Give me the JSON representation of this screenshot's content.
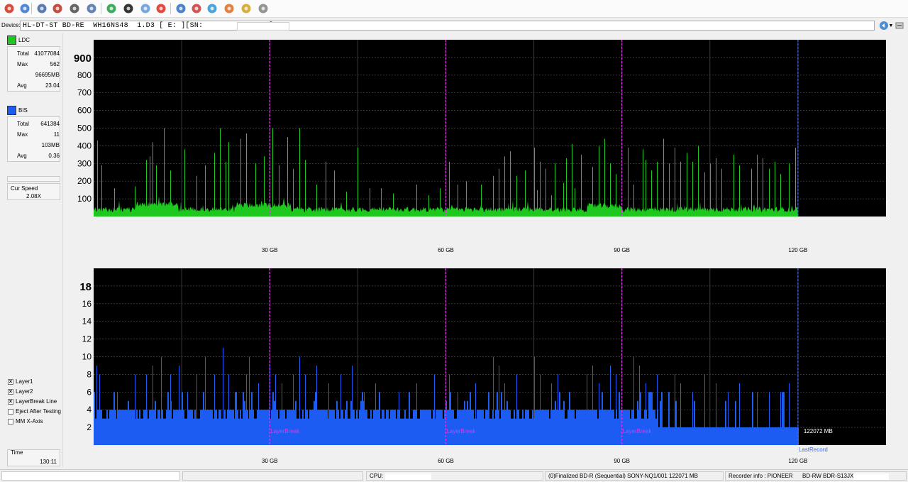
{
  "toolbar": {
    "buttons": [
      {
        "name": "power-icon",
        "color": "#d23a2a"
      },
      {
        "name": "settings-disc-icon",
        "color": "#3d7bd6"
      },
      {
        "name": "drive-info-icon",
        "color": "#4b6ea8"
      },
      {
        "name": "disc-burn-icon",
        "color": "#c0392b"
      },
      {
        "name": "drive-icon",
        "color": "#555555"
      },
      {
        "name": "copy-icon",
        "color": "#5577aa"
      },
      {
        "name": "refresh-icon",
        "color": "#2aa24a"
      },
      {
        "name": "start-test-icon",
        "color": "#1f1f1f"
      },
      {
        "name": "scan-icon",
        "color": "#6aa0d8"
      },
      {
        "name": "stop-icon",
        "color": "#e0362b"
      },
      {
        "name": "disc-icon",
        "color": "#3a76c4"
      },
      {
        "name": "erase-icon",
        "color": "#c44"
      },
      {
        "name": "save-icon",
        "color": "#3a9ad4"
      },
      {
        "name": "burn-icon",
        "color": "#e0732b"
      },
      {
        "name": "chart-icon",
        "color": "#d4a62a"
      },
      {
        "name": "eject-icon",
        "color": "#888888"
      }
    ]
  },
  "device": {
    "label": "Device:",
    "value": "HL-DT-ST BD-RE  WH16NS48  1.D3 [ E: ][SN:               ]"
  },
  "ldc": {
    "label": "LDC",
    "color": "#1ec81e",
    "total_label": "Total",
    "total": "41077084",
    "max_label": "Max",
    "max": "562",
    "size": "96695MB",
    "avg_label": "Avg",
    "avg": "23.04"
  },
  "bis": {
    "label": "BIS",
    "color": "#1c5cf2",
    "total_label": "Total",
    "total": "641384",
    "max_label": "Max",
    "max": "11",
    "size": "103MB",
    "avg_label": "Avg",
    "avg": "0.36"
  },
  "speed": {
    "label": "Cur Speed",
    "value": "2.08X"
  },
  "options": [
    {
      "label": "Layer1",
      "checked": true
    },
    {
      "label": "Layer2",
      "checked": true
    },
    {
      "label": "LayerBreak Line",
      "checked": true
    },
    {
      "label": "Eject After Testing",
      "checked": false
    },
    {
      "label": "MM X-Axis",
      "checked": false
    }
  ],
  "time": {
    "label": "Time",
    "value": "130:11"
  },
  "chart_data": [
    {
      "type": "area",
      "series": [
        {
          "name": "LDC"
        }
      ],
      "x_range_gb": [
        0,
        135
      ],
      "y_range": [
        0,
        1000
      ],
      "y_ticks": [
        100,
        200,
        300,
        400,
        500,
        600,
        700,
        800,
        900
      ],
      "y_top_label": "900",
      "x_ticks_gb": [
        30,
        60,
        90,
        120
      ],
      "x_tick_labels": [
        "30 GB",
        "60 GB",
        "90 GB",
        "120 GB"
      ],
      "layer_breaks_gb": [
        30,
        60,
        90
      ],
      "end_gb": 120,
      "baseline": 35,
      "max": 562,
      "spikes": [
        [
          0.6,
          430
        ],
        [
          1.3,
          290
        ],
        [
          3.5,
          160
        ],
        [
          7,
          170
        ],
        [
          9,
          320
        ],
        [
          9.6,
          340
        ],
        [
          10,
          420
        ],
        [
          10.6,
          290
        ],
        [
          12,
          500
        ],
        [
          13,
          260
        ],
        [
          15.5,
          380
        ],
        [
          17.5,
          230
        ],
        [
          19,
          290
        ],
        [
          20.5,
          360
        ],
        [
          21.5,
          500
        ],
        [
          22.5,
          310
        ],
        [
          23,
          420
        ],
        [
          25,
          440
        ],
        [
          26,
          470
        ],
        [
          27.5,
          300
        ],
        [
          29,
          340
        ],
        [
          30.5,
          500
        ],
        [
          31.5,
          290
        ],
        [
          33,
          450
        ],
        [
          34,
          270
        ],
        [
          35,
          500
        ],
        [
          36,
          320
        ],
        [
          38,
          180
        ],
        [
          39.5,
          310
        ],
        [
          41,
          260
        ],
        [
          43,
          140
        ],
        [
          45,
          390
        ],
        [
          47,
          160
        ],
        [
          49,
          160
        ],
        [
          51,
          130
        ],
        [
          55,
          180
        ],
        [
          57,
          120
        ],
        [
          59,
          160
        ],
        [
          60.5,
          310
        ],
        [
          62,
          180
        ],
        [
          63.5,
          200
        ],
        [
          66,
          180
        ],
        [
          68,
          230
        ],
        [
          69,
          270
        ],
        [
          70,
          340
        ],
        [
          71,
          370
        ],
        [
          72,
          230
        ],
        [
          73.5,
          260
        ],
        [
          75.5,
          150
        ],
        [
          77,
          270
        ],
        [
          78,
          120
        ],
        [
          80,
          190
        ],
        [
          82,
          160
        ],
        [
          75,
          390
        ],
        [
          76,
          310
        ],
        [
          78.5,
          300
        ],
        [
          80.5,
          330
        ],
        [
          81.5,
          410
        ],
        [
          83,
          350
        ],
        [
          85,
          280
        ],
        [
          86,
          400
        ],
        [
          87,
          440
        ],
        [
          88,
          300
        ],
        [
          89,
          240
        ],
        [
          91,
          390
        ],
        [
          92,
          180
        ],
        [
          93.5,
          380
        ],
        [
          94,
          320
        ],
        [
          95,
          260
        ],
        [
          96,
          310
        ],
        [
          97,
          440
        ],
        [
          98,
          300
        ],
        [
          99,
          390
        ],
        [
          100,
          310
        ],
        [
          101,
          360
        ],
        [
          102,
          310
        ],
        [
          103,
          400
        ],
        [
          104,
          250
        ],
        [
          105,
          300
        ],
        [
          106,
          330
        ],
        [
          107,
          270
        ],
        [
          109,
          350
        ],
        [
          110,
          290
        ],
        [
          112,
          270
        ],
        [
          113,
          350
        ],
        [
          114,
          330
        ],
        [
          115,
          270
        ],
        [
          116,
          310
        ],
        [
          117,
          240
        ],
        [
          118.5,
          300
        ],
        [
          119.5,
          390
        ]
      ]
    },
    {
      "type": "area",
      "series": [
        {
          "name": "BIS"
        }
      ],
      "x_range_gb": [
        0,
        135
      ],
      "y_range": [
        0,
        20
      ],
      "y_ticks": [
        2,
        4,
        6,
        8,
        10,
        12,
        14,
        16,
        18
      ],
      "y_top_label": "18",
      "x_ticks_gb": [
        30,
        60,
        90,
        120
      ],
      "x_tick_labels": [
        "30 GB",
        "60 GB",
        "90 GB",
        "120 GB"
      ],
      "layer_breaks_gb": [
        30,
        60,
        90
      ],
      "layer_break_label": "LayerBreak",
      "end_gb": 120,
      "end_label": "122072 MB",
      "last_record_label": "LastRecord",
      "baseline": 3,
      "max": 11,
      "spikes": [
        [
          0.5,
          9
        ],
        [
          1,
          8
        ],
        [
          4,
          6
        ],
        [
          7,
          8
        ],
        [
          9,
          8
        ],
        [
          10,
          9
        ],
        [
          11.5,
          10
        ],
        [
          13,
          8
        ],
        [
          14.5,
          9
        ],
        [
          16,
          6
        ],
        [
          17.5,
          8
        ],
        [
          19,
          10
        ],
        [
          20.5,
          8
        ],
        [
          22,
          11
        ],
        [
          23,
          8
        ],
        [
          24,
          6
        ],
        [
          26,
          8
        ],
        [
          26.5,
          10
        ],
        [
          28,
          7
        ],
        [
          30,
          9
        ],
        [
          31,
          8
        ],
        [
          32,
          7
        ],
        [
          34,
          8
        ],
        [
          35,
          10
        ],
        [
          36,
          8
        ],
        [
          38,
          9
        ],
        [
          40,
          7
        ],
        [
          42,
          8
        ],
        [
          44,
          9
        ],
        [
          46,
          6
        ],
        [
          48,
          7
        ],
        [
          52,
          6
        ],
        [
          55,
          7
        ],
        [
          58,
          8
        ],
        [
          60.5,
          8
        ],
        [
          62,
          6
        ],
        [
          65,
          7
        ],
        [
          68,
          10
        ],
        [
          69,
          9
        ],
        [
          70,
          7
        ],
        [
          72,
          8
        ],
        [
          75,
          10
        ],
        [
          76,
          8
        ],
        [
          78,
          7
        ],
        [
          79,
          8
        ],
        [
          81,
          6
        ],
        [
          84,
          8
        ],
        [
          85,
          9
        ],
        [
          86,
          7
        ],
        [
          88,
          9
        ],
        [
          89,
          8
        ],
        [
          92,
          10
        ],
        [
          93,
          9
        ],
        [
          94,
          7
        ],
        [
          96,
          8
        ],
        [
          98,
          6
        ],
        [
          99,
          8
        ],
        [
          100,
          7
        ],
        [
          102,
          6
        ],
        [
          104,
          8
        ],
        [
          106,
          7
        ],
        [
          108,
          6
        ],
        [
          110,
          7
        ],
        [
          113,
          6
        ],
        [
          115,
          6
        ],
        [
          117,
          6
        ],
        [
          118.5,
          7
        ]
      ]
    }
  ],
  "status": {
    "cpu_label": "CPU:",
    "disc_info": "(0)Finalized  BD-R (Sequential)  SONY-NQ1/001  122071 MB",
    "recorder_label": "Recorder info : PIONEER",
    "recorder_model": "BD-RW  BDR-S13JX"
  }
}
